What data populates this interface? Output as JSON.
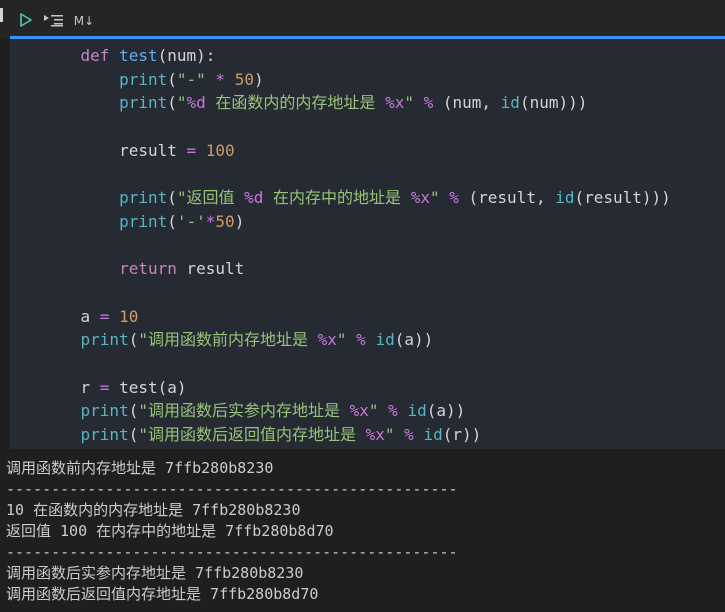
{
  "toolbar": {
    "run_icon": "play-icon",
    "outline_icon": "list-outline-icon",
    "markdown_label": "M↓"
  },
  "code_lines": [
    [
      {
        "t": "    ",
        "c": "id"
      },
      {
        "t": "def",
        "c": "kw"
      },
      {
        "t": " ",
        "c": "id"
      },
      {
        "t": "test",
        "c": "fn"
      },
      {
        "t": "(num):",
        "c": "id"
      }
    ],
    [
      {
        "t": "        ",
        "c": "id"
      },
      {
        "t": "print",
        "c": "bi"
      },
      {
        "t": "(",
        "c": "id"
      },
      {
        "t": "\"-\"",
        "c": "str"
      },
      {
        "t": " * ",
        "c": "op"
      },
      {
        "t": "50",
        "c": "num"
      },
      {
        "t": ")",
        "c": "id"
      }
    ],
    [
      {
        "t": "        ",
        "c": "id"
      },
      {
        "t": "print",
        "c": "bi"
      },
      {
        "t": "(",
        "c": "id"
      },
      {
        "t": "\"",
        "c": "str"
      },
      {
        "t": "%d",
        "c": "fmt"
      },
      {
        "t": " 在函数内的内存地址是 ",
        "c": "str"
      },
      {
        "t": "%x",
        "c": "fmt"
      },
      {
        "t": "\"",
        "c": "str"
      },
      {
        "t": " % ",
        "c": "op"
      },
      {
        "t": "(num, ",
        "c": "id"
      },
      {
        "t": "id",
        "c": "bi"
      },
      {
        "t": "(num)))",
        "c": "id"
      }
    ],
    [],
    [
      {
        "t": "        result ",
        "c": "id"
      },
      {
        "t": "=",
        "c": "op"
      },
      {
        "t": " ",
        "c": "id"
      },
      {
        "t": "100",
        "c": "num"
      }
    ],
    [],
    [
      {
        "t": "        ",
        "c": "id"
      },
      {
        "t": "print",
        "c": "bi"
      },
      {
        "t": "(",
        "c": "id"
      },
      {
        "t": "\"返回值 ",
        "c": "str"
      },
      {
        "t": "%d",
        "c": "fmt"
      },
      {
        "t": " 在内存中的地址是 ",
        "c": "str"
      },
      {
        "t": "%x",
        "c": "fmt"
      },
      {
        "t": "\"",
        "c": "str"
      },
      {
        "t": " % ",
        "c": "op"
      },
      {
        "t": "(result, ",
        "c": "id"
      },
      {
        "t": "id",
        "c": "bi"
      },
      {
        "t": "(result)))",
        "c": "id"
      }
    ],
    [
      {
        "t": "        ",
        "c": "id"
      },
      {
        "t": "print",
        "c": "bi"
      },
      {
        "t": "(",
        "c": "id"
      },
      {
        "t": "'-'",
        "c": "str"
      },
      {
        "t": "*",
        "c": "op"
      },
      {
        "t": "50",
        "c": "num"
      },
      {
        "t": ")",
        "c": "id"
      }
    ],
    [],
    [
      {
        "t": "        ",
        "c": "id"
      },
      {
        "t": "return",
        "c": "kw"
      },
      {
        "t": " result",
        "c": "id"
      }
    ],
    [],
    [
      {
        "t": "    a ",
        "c": "id"
      },
      {
        "t": "=",
        "c": "op"
      },
      {
        "t": " ",
        "c": "id"
      },
      {
        "t": "10",
        "c": "num"
      }
    ],
    [
      {
        "t": "    ",
        "c": "id"
      },
      {
        "t": "print",
        "c": "bi"
      },
      {
        "t": "(",
        "c": "id"
      },
      {
        "t": "\"调用函数前内存地址是 ",
        "c": "str"
      },
      {
        "t": "%x",
        "c": "fmt"
      },
      {
        "t": "\"",
        "c": "str"
      },
      {
        "t": " % ",
        "c": "op"
      },
      {
        "t": "id",
        "c": "bi"
      },
      {
        "t": "(a))",
        "c": "id"
      }
    ],
    [],
    [
      {
        "t": "    r ",
        "c": "id"
      },
      {
        "t": "=",
        "c": "op"
      },
      {
        "t": " test(a)",
        "c": "id"
      }
    ],
    [
      {
        "t": "    ",
        "c": "id"
      },
      {
        "t": "print",
        "c": "bi"
      },
      {
        "t": "(",
        "c": "id"
      },
      {
        "t": "\"调用函数后实参内存地址是 ",
        "c": "str"
      },
      {
        "t": "%x",
        "c": "fmt"
      },
      {
        "t": "\"",
        "c": "str"
      },
      {
        "t": " % ",
        "c": "op"
      },
      {
        "t": "id",
        "c": "bi"
      },
      {
        "t": "(a))",
        "c": "id"
      }
    ],
    [
      {
        "t": "    ",
        "c": "id"
      },
      {
        "t": "print",
        "c": "bi"
      },
      {
        "t": "(",
        "c": "id"
      },
      {
        "t": "\"调用函数后返回值内存地址是 ",
        "c": "str"
      },
      {
        "t": "%x",
        "c": "fmt"
      },
      {
        "t": "\"",
        "c": "str"
      },
      {
        "t": " % ",
        "c": "op"
      },
      {
        "t": "id",
        "c": "bi"
      },
      {
        "t": "(r))",
        "c": "id"
      }
    ]
  ],
  "output_lines": [
    "调用函数前内存地址是 7ffb280b8230",
    "--------------------------------------------------",
    "10 在函数内的内存地址是 7ffb280b8230",
    "返回值 100 在内存中的地址是 7ffb280b8d70",
    "--------------------------------------------------",
    "调用函数后实参内存地址是 7ffb280b8230",
    "调用函数后返回值内存地址是 7ffb280b8d70"
  ]
}
